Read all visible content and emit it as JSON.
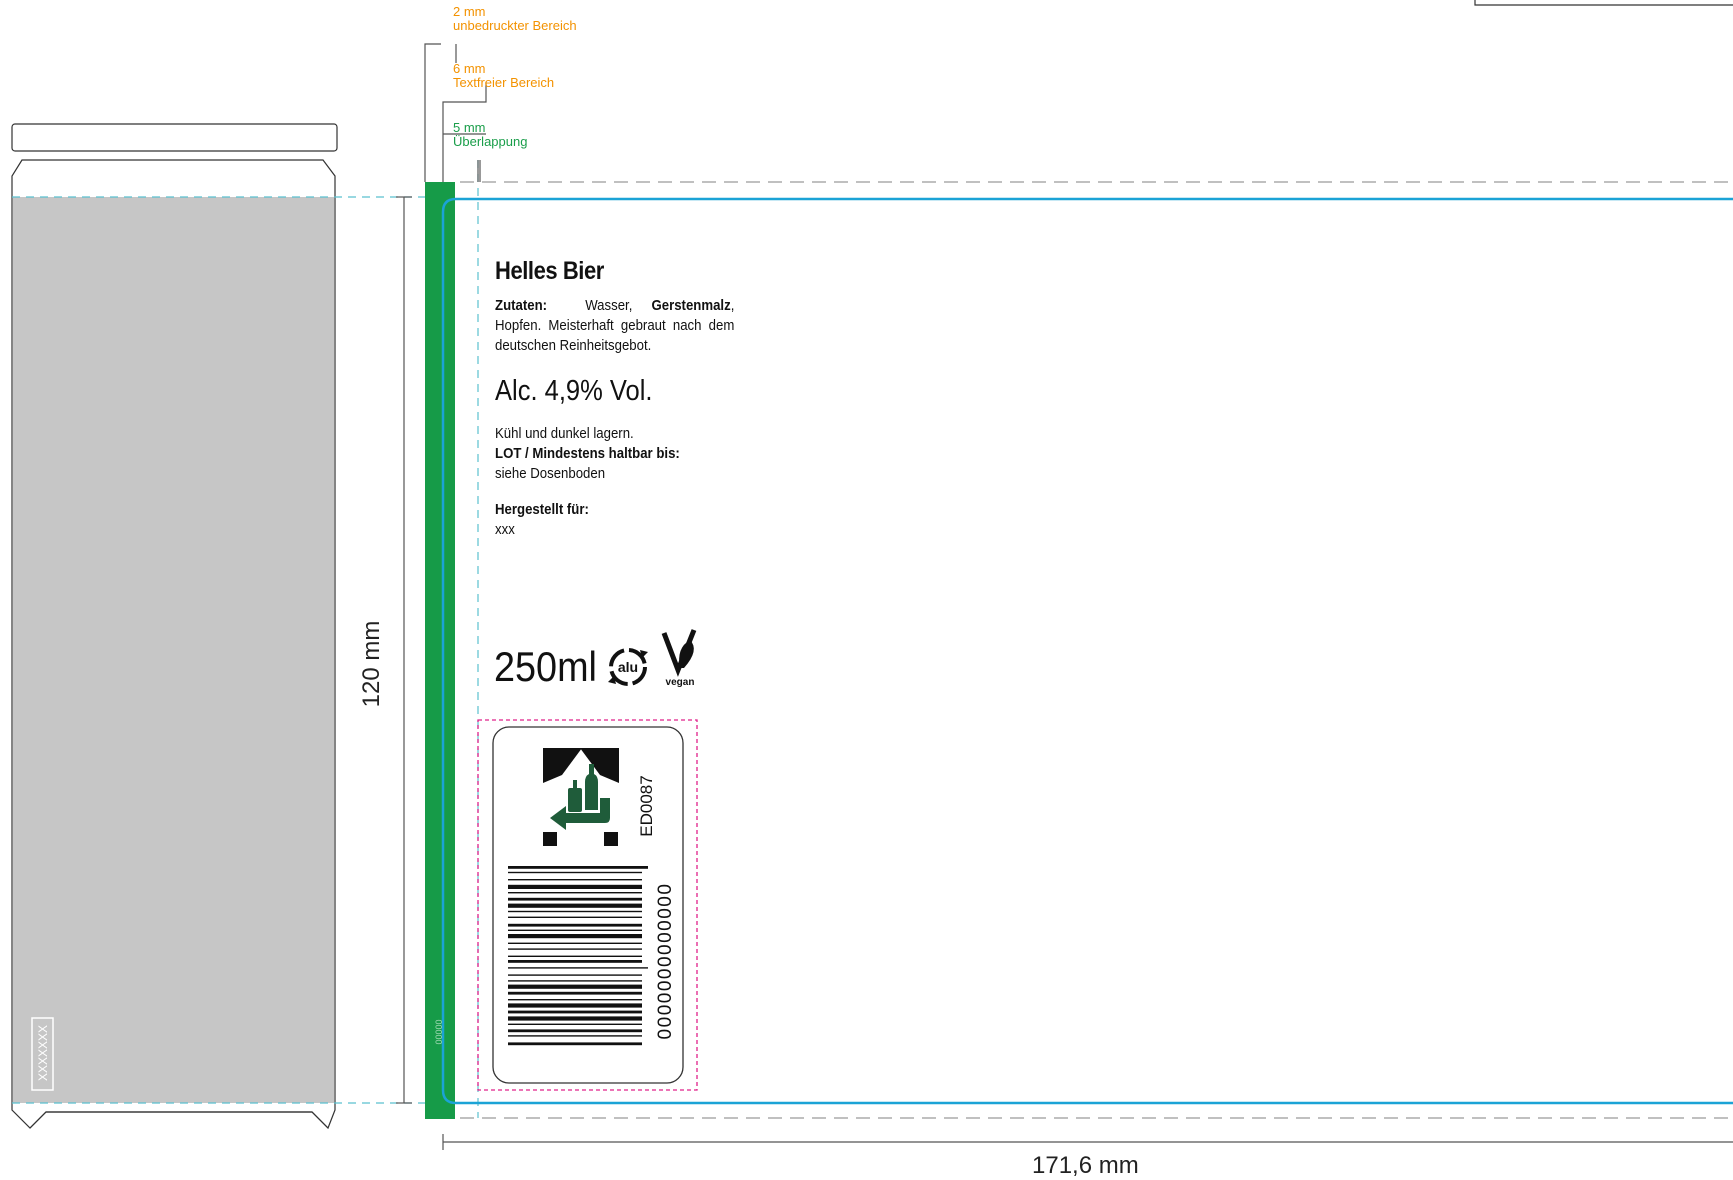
{
  "annotations": {
    "unprinted": {
      "size": "2 mm",
      "label": "unbedruckter Bereich"
    },
    "textfree": {
      "size": "6 mm",
      "label": "Textfreier Bereich"
    },
    "overlap": {
      "size": "5 mm",
      "label": "Überlappung"
    }
  },
  "dimensions": {
    "height": "120 mm",
    "width": "171,6 mm"
  },
  "can": {
    "bottom_code": "XXXXXXX"
  },
  "label": {
    "title": "Helles Bier",
    "ingredients_heading": "Zutaten:",
    "ingredients_1": "Wasser,",
    "ingredients_malt": "Gerstenmalz",
    "ingredients_2": ", Hopfen. Meisterhaft gebraut nach dem deutschen Reinheitsgebot.",
    "alcohol": "Alc. 4,9% Vol.",
    "storage": "Kühl und dunkel lagern.",
    "lot_heading": "LOT / Mindestens haltbar bis:",
    "lot_value": "siehe Dosenboden",
    "made_for_heading": "Hergestellt für:",
    "made_for_value": "xxx",
    "volume": "250ml",
    "alu_icon_text": "alu",
    "vegan_text": "vegan",
    "deposit_code": "ED0087",
    "barcode_number": "0000000000000",
    "overlap_code": "00000"
  },
  "colors": {
    "overlap_green": "#169b48",
    "cut_line": "#1ba3d6",
    "guide_dashed": "#5bc0cf",
    "safe_area": "#e0218a",
    "can_fill": "#c6c6c6",
    "orange": "#f39200",
    "deposit_green": "#1f5c3a"
  }
}
